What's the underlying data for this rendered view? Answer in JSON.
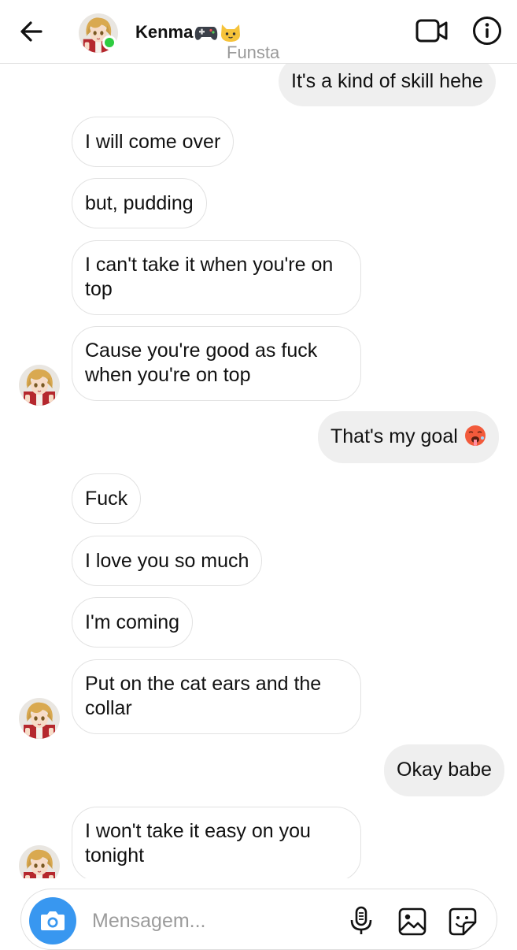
{
  "header": {
    "contact_name": "Kenma",
    "name_emojis": [
      "game-controller-emoji",
      "cat-face-emoji"
    ],
    "subtitle": "Funsta",
    "online": true,
    "status_color": "#2ecc40"
  },
  "messages": [
    {
      "direction": "outgoing",
      "text": "It's a kind of skill hehe"
    },
    {
      "direction": "incoming",
      "text": "I will come over"
    },
    {
      "direction": "incoming",
      "text": "but, pudding"
    },
    {
      "direction": "incoming",
      "text": "I can't take it when you're on top"
    },
    {
      "direction": "incoming",
      "text": "Cause you're good as fuck when you're on top",
      "avatar": true
    },
    {
      "direction": "outgoing",
      "text": "That's my goal",
      "emoji": "hot-face-emoji"
    },
    {
      "direction": "incoming",
      "text": "Fuck"
    },
    {
      "direction": "incoming",
      "text": "I love you so much"
    },
    {
      "direction": "incoming",
      "text": "I'm coming"
    },
    {
      "direction": "incoming",
      "text": "Put on the cat ears and the collar",
      "avatar": true
    },
    {
      "direction": "outgoing",
      "text": "Okay babe"
    },
    {
      "direction": "incoming",
      "text": "I won't take it easy on you tonight",
      "avatar": true
    }
  ],
  "composer": {
    "placeholder": "Mensagem...",
    "accent_color": "#3897f0"
  },
  "icons": [
    "back-arrow-icon",
    "video-call-icon",
    "info-icon",
    "camera-icon",
    "microphone-icon",
    "gallery-icon",
    "sticker-icon"
  ]
}
